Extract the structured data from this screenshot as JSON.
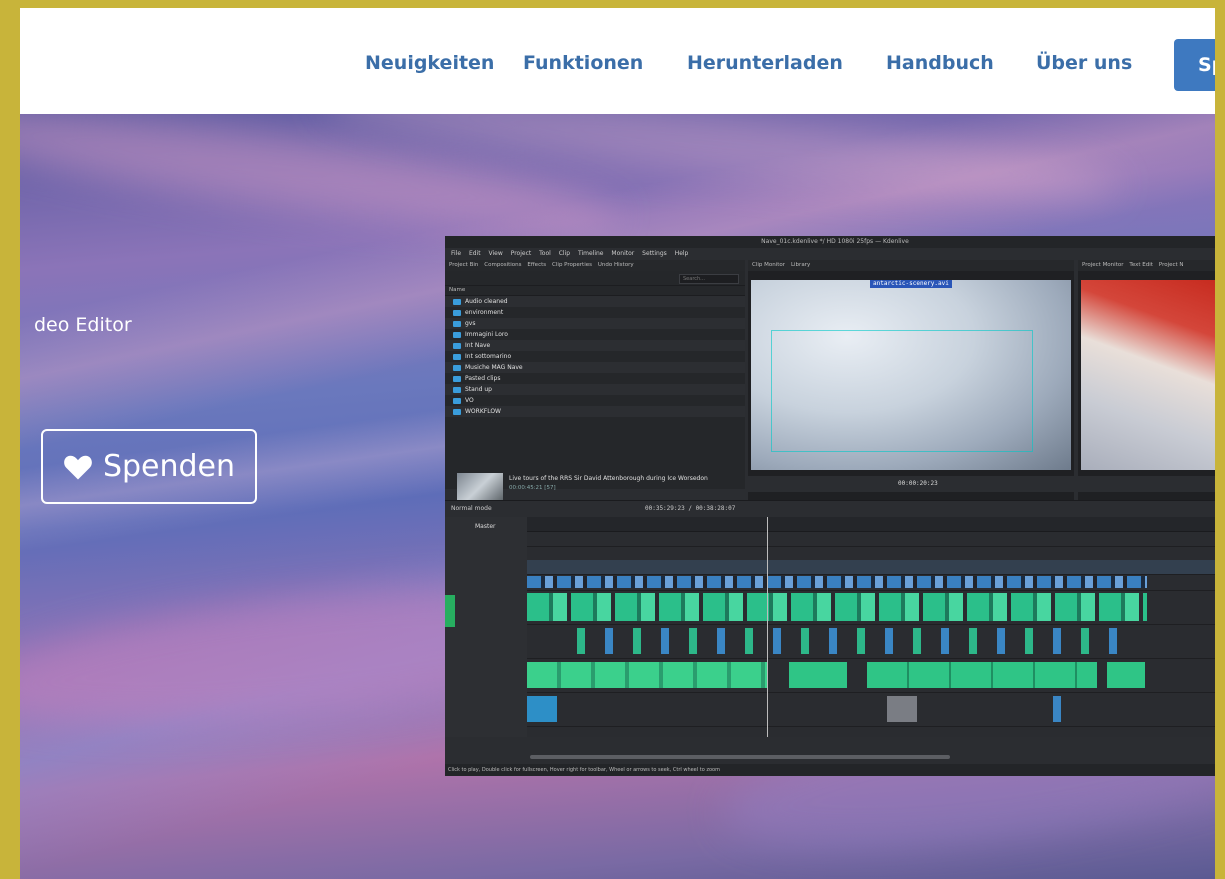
{
  "nav": {
    "links": [
      "Neuigkeiten",
      "Funktionen",
      "Herunterladen",
      "Handbuch",
      "Über uns"
    ],
    "cta_label": "Sp"
  },
  "hero": {
    "subtitle": "deo Editor",
    "donate_label": "Spenden",
    "donate_icon": "heart-icon"
  },
  "screenshot": {
    "window_title": "Nave_01c.kdenlive */ HD 1080i 25fps — Kdenlive",
    "menu": [
      "File",
      "Edit",
      "View",
      "Project",
      "Tool",
      "Clip",
      "Timeline",
      "Monitor",
      "Settings",
      "Help"
    ],
    "left_tabs": [
      "Project Bin",
      "Compositions",
      "Effects",
      "Clip Properties",
      "Undo History"
    ],
    "bin_header": "Name",
    "search_placeholder": "Search...",
    "folders": [
      "Audio cleaned",
      "environment",
      "gvs",
      "Immagini Loro",
      "Int Nave",
      "Int sottomarino",
      "Musiche MAG Nave",
      "Pasted clips",
      "Stand up",
      "VO",
      "WORKFLOW"
    ],
    "clip_title": "Live tours of the RRS Sir David Attenborough during Ice Worsedon",
    "clip_meta": "00:00:45:21 [57]",
    "monitor1_tabs": [
      "Clip Monitor",
      "Library"
    ],
    "monitor1_clip_label": "antarctic-scenery.avi",
    "monitor1_time": "00:00:20:23",
    "monitor2_tabs": [
      "Project Monitor",
      "Text Edit",
      "Project N"
    ],
    "timeline_mode": "Normal mode",
    "timeline_time": "00:35:29:23 / 00:38:28:07",
    "master_label": "Master",
    "statusbar": "Click to play, Double click for fullscreen, Hover right for toolbar, Wheel or arrows to seek, Ctrl wheel to zoom"
  }
}
